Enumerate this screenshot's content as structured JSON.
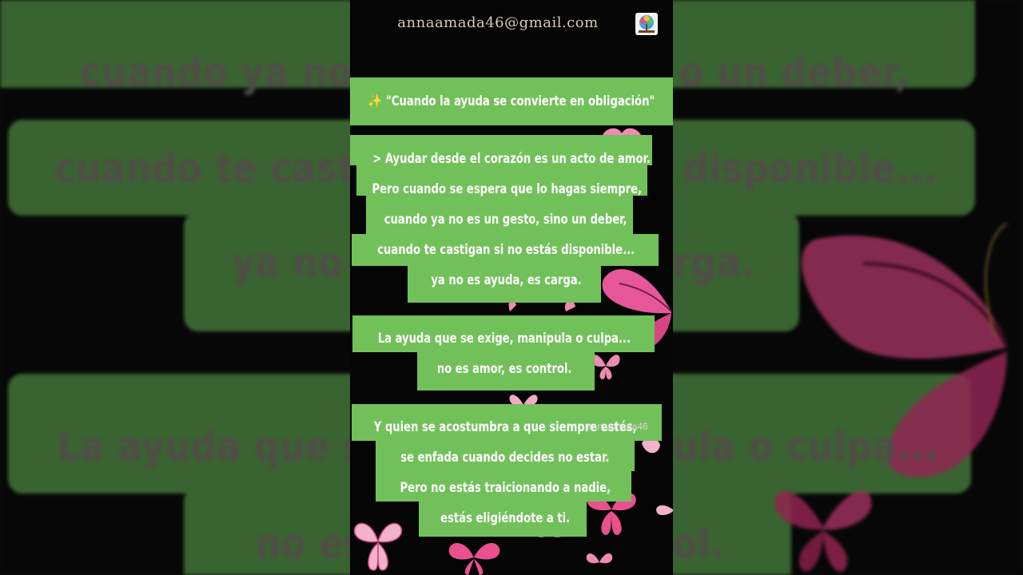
{
  "header": {
    "email": "annaamada46@gmail.com"
  },
  "title": {
    "sparkle_icon": "sparkles-emoji",
    "text": "✨ \"Cuando la ayuda se convierte en obligación\""
  },
  "paragraph1": {
    "lines": [
      "> Ayudar desde el corazón es un acto de amor.",
      "Pero cuando se espera que lo hagas siempre,",
      "cuando ya no es un gesto, sino un deber,",
      "cuando te castigan si no estás disponible...",
      "ya no es ayuda, es carga."
    ]
  },
  "paragraph2": {
    "lines": [
      "La ayuda que se exige, manipula o culpa...",
      "no es amor, es control."
    ]
  },
  "paragraph3": {
    "lines": [
      "Y quien se acostumbra a que siempre estés,",
      "se enfada cuando decides no estar.",
      "Pero no estás traicionando a nadie,",
      "estás eligiéndote a ti."
    ]
  },
  "watermark": "annaamada46",
  "background": {
    "lines": [
      "cuando ya no",
      "o un deber,",
      "cuando te cast",
      "disponible...",
      "ya no",
      "rga.",
      "La ayuda que s",
      "ula o culpa...",
      "no es",
      "ol."
    ]
  },
  "colors": {
    "green": "#72c05a",
    "background": "#050505",
    "butterfly_pink": "#e0427e",
    "email_text": "#d9cbb3"
  }
}
